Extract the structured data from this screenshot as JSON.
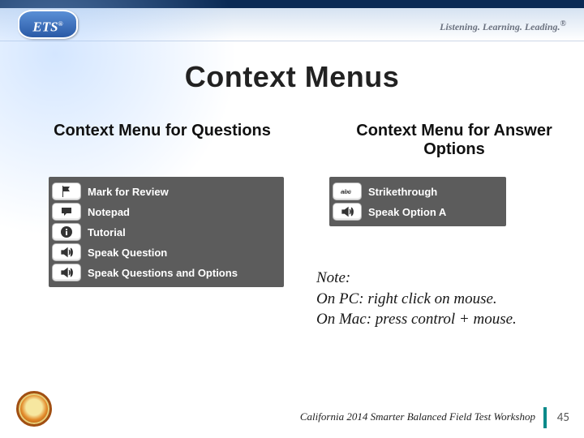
{
  "header": {
    "logo_text": "ETS",
    "tagline": "Listening. Learning. Leading."
  },
  "title": "Context Menus",
  "columns": {
    "left_heading": "Context Menu for Questions",
    "right_heading": "Context Menu for Answer Options"
  },
  "menus": {
    "questions": [
      {
        "icon": "flag-icon",
        "label": "Mark for Review"
      },
      {
        "icon": "speech-icon",
        "label": "Notepad"
      },
      {
        "icon": "info-icon",
        "label": "Tutorial"
      },
      {
        "icon": "speaker-icon",
        "label": "Speak Question"
      },
      {
        "icon": "speaker-icon",
        "label": "Speak Questions and Options"
      }
    ],
    "answers": [
      {
        "icon": "strike-icon",
        "label": "Strikethrough"
      },
      {
        "icon": "speaker-icon",
        "label": "Speak Option A"
      }
    ]
  },
  "note": {
    "line1": "Note:",
    "line2": "On PC: right click on mouse.",
    "line3": "On Mac: press control + mouse."
  },
  "footer": {
    "text": "California 2014 Smarter Balanced Field Test Workshop",
    "page": "45"
  }
}
